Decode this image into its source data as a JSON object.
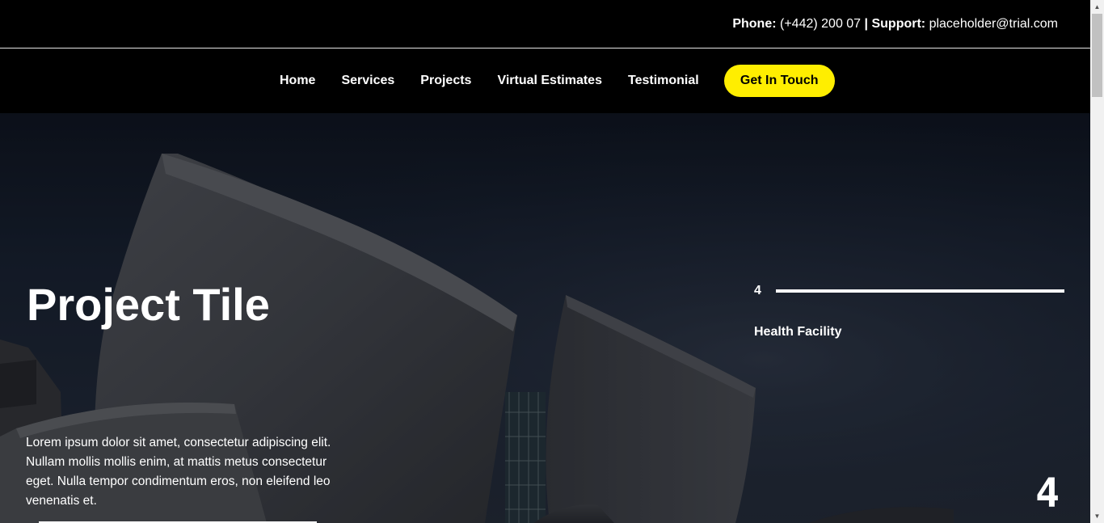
{
  "topbar": {
    "phone_label": "Phone:",
    "phone_value": "(+442) 200 07",
    "separator": "|",
    "support_label": "Support:",
    "support_value": "placeholder@trial.com"
  },
  "nav": {
    "items": [
      {
        "label": "Home"
      },
      {
        "label": "Services"
      },
      {
        "label": "Projects"
      },
      {
        "label": "Virtual Estimates"
      },
      {
        "label": "Testimonial"
      }
    ],
    "cta_label": "Get In Touch"
  },
  "hero": {
    "title": "Project Tile",
    "description": "Lorem ipsum dolor sit amet, consectetur adipiscing elit. Nullam mollis mollis enim, at mattis metus consectetur eget. Nulla tempor condimentum eros, non eleifend leo venenatis et.",
    "counter_number": "4",
    "counter_label": "Health Facility",
    "big_number": "4"
  },
  "colors": {
    "accent": "#ffee00",
    "background": "#000000",
    "text": "#ffffff"
  },
  "icons": {
    "scroll_up": "caret-up-icon",
    "scroll_down": "caret-down-icon"
  }
}
